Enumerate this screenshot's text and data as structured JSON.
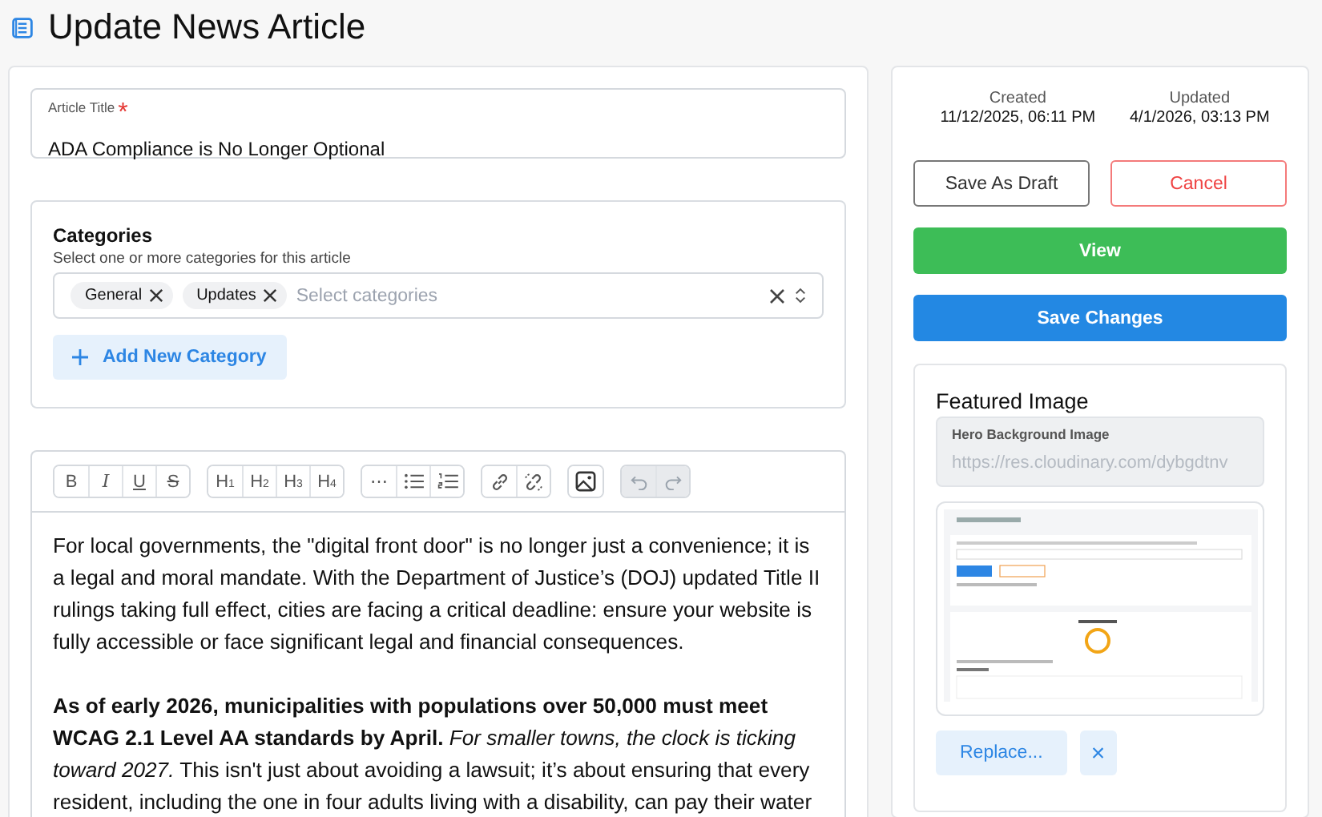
{
  "page": {
    "title": "Update News Article"
  },
  "title_field": {
    "label": "Article Title",
    "required_mark": "*",
    "value": "ADA Compliance is No Longer Optional"
  },
  "categories": {
    "heading": "Categories",
    "hint": "Select one or more categories for this article",
    "placeholder": "Select categories",
    "tags": [
      {
        "label": "General"
      },
      {
        "label": "Updates"
      }
    ],
    "add_button": "Add New Category"
  },
  "editor": {
    "toolbar": [
      [
        {
          "kind": "bold",
          "label": "B",
          "disabled": false
        },
        {
          "kind": "italic",
          "label": "I",
          "disabled": false
        },
        {
          "kind": "underline",
          "label": "U",
          "disabled": false
        },
        {
          "kind": "strike",
          "label": "S",
          "disabled": false
        }
      ],
      [
        {
          "kind": "heading",
          "label": "H",
          "sub": "1",
          "disabled": false
        },
        {
          "kind": "heading",
          "label": "H",
          "sub": "2",
          "disabled": false
        },
        {
          "kind": "heading",
          "label": "H",
          "sub": "3",
          "disabled": false
        },
        {
          "kind": "heading",
          "label": "H",
          "sub": "4",
          "disabled": false
        }
      ],
      [
        {
          "kind": "text",
          "label": "⋯",
          "disabled": false
        },
        {
          "kind": "bullet-list",
          "disabled": false
        },
        {
          "kind": "ordered-list",
          "disabled": false
        }
      ],
      [
        {
          "kind": "link",
          "disabled": false
        },
        {
          "kind": "unlink",
          "disabled": false
        }
      ],
      [
        {
          "kind": "image",
          "disabled": false
        }
      ],
      [
        {
          "kind": "undo",
          "disabled": true
        },
        {
          "kind": "redo",
          "disabled": true
        }
      ]
    ],
    "paragraphs": [
      "For local governments, the \"digital front door\" is no longer just a convenience; it is a legal and moral mandate. With the Department of Justice’s (DOJ) updated Title II rulings taking full effect, cities are facing a critical deadline: ensure your website is fully accessible or face significant legal and financial consequences.",
      "**As of early 2026, municipalities with populations over 50,000 must meet WCAG 2.1 Level AA standards by April.** *For smaller towns, the clock is ticking toward 2027.* This isn't just about avoiding a lawsuit; it’s about ensuring that every resident, including the one in four adults living with a disability, can pay their water"
    ]
  },
  "meta": [
    {
      "label": "Created",
      "value": "11/12/2025, 06:11 PM"
    },
    {
      "label": "Updated",
      "value": "4/1/2026, 03:13 PM"
    }
  ],
  "actions": [
    {
      "label": "Save As Draft",
      "kind": "outline"
    },
    {
      "label": "Cancel",
      "kind": "danger"
    },
    {
      "label": "View",
      "kind": "success"
    },
    {
      "label": "Save Changes",
      "kind": "primary"
    }
  ],
  "featured": {
    "heading": "Featured Image",
    "field_label": "Hero Background Image",
    "field_value": "https://res.cloudinary.com/dybgdtnv",
    "replace_button": "Replace...",
    "remove_button": "×"
  }
}
